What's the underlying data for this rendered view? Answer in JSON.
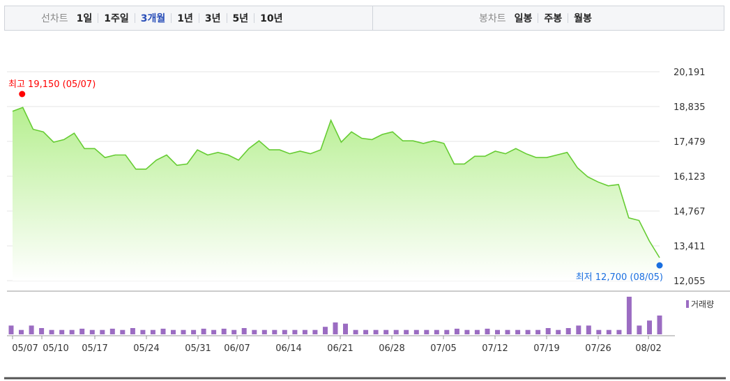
{
  "tabs": {
    "line_label": "선차트",
    "periods": [
      "1일",
      "1주일",
      "3개월",
      "1년",
      "3년",
      "5년",
      "10년"
    ],
    "active_period": "3개월",
    "candle_label": "봉차트",
    "candle_periods": [
      "일봉",
      "주봉",
      "월봉"
    ]
  },
  "annotations": {
    "high_label": "최고 19,150 (05/07)",
    "low_label": "최저 12,700 (08/05)",
    "high_color": "#ff0000",
    "low_color": "#1a6fe0"
  },
  "volume_legend": "거래량",
  "colors": {
    "line": "#66cc33",
    "area_top": "#b6ef90",
    "area_bottom": "#ffffff",
    "volume": "#9b6cc2",
    "grid": "#e6e6e6"
  },
  "chart_data": {
    "type": "line",
    "ylim": [
      12055,
      20191
    ],
    "y_ticks": [
      "20,191",
      "18,835",
      "17,479",
      "16,123",
      "14,767",
      "13,411",
      "12,055"
    ],
    "x_tick_labels": [
      "05/07",
      "05/10",
      "05/17",
      "05/24",
      "05/31",
      "06/07",
      "06/14",
      "06/21",
      "06/28",
      "07/05",
      "07/12",
      "07/19",
      "07/26",
      "08/02"
    ],
    "series": [
      {
        "values": [
          18650,
          18800,
          17950,
          17850,
          17450,
          17550,
          17800,
          17200,
          17200,
          16850,
          16950,
          16950,
          16400,
          16400,
          16750,
          16950,
          16550,
          16600,
          17150,
          16950,
          17050,
          16950,
          16750,
          17200,
          17500,
          17150,
          17150,
          17000,
          17100,
          17000,
          17150,
          18300,
          17450,
          17850,
          17600,
          17550,
          17750,
          17850,
          17500,
          17500,
          17400,
          17500,
          17400,
          16600,
          16600,
          16900,
          16900,
          17100,
          17000,
          17200,
          17000,
          16850,
          16850,
          16950,
          17050,
          16450,
          16100,
          15900,
          15750,
          15800,
          14500,
          14400,
          13600,
          12950
        ]
      }
    ],
    "volume": {
      "name": "거래량",
      "values": [
        14,
        7,
        14,
        10,
        7,
        7,
        7,
        9,
        7,
        7,
        9,
        7,
        10,
        7,
        7,
        9,
        7,
        7,
        7,
        9,
        7,
        9,
        7,
        10,
        7,
        7,
        7,
        7,
        7,
        7,
        7,
        12,
        19,
        17,
        7,
        7,
        7,
        7,
        7,
        7,
        7,
        7,
        7,
        7,
        9,
        7,
        7,
        9,
        7,
        7,
        7,
        7,
        7,
        10,
        7,
        10,
        14,
        14,
        7,
        7,
        7,
        60,
        14,
        22,
        30
      ]
    }
  }
}
